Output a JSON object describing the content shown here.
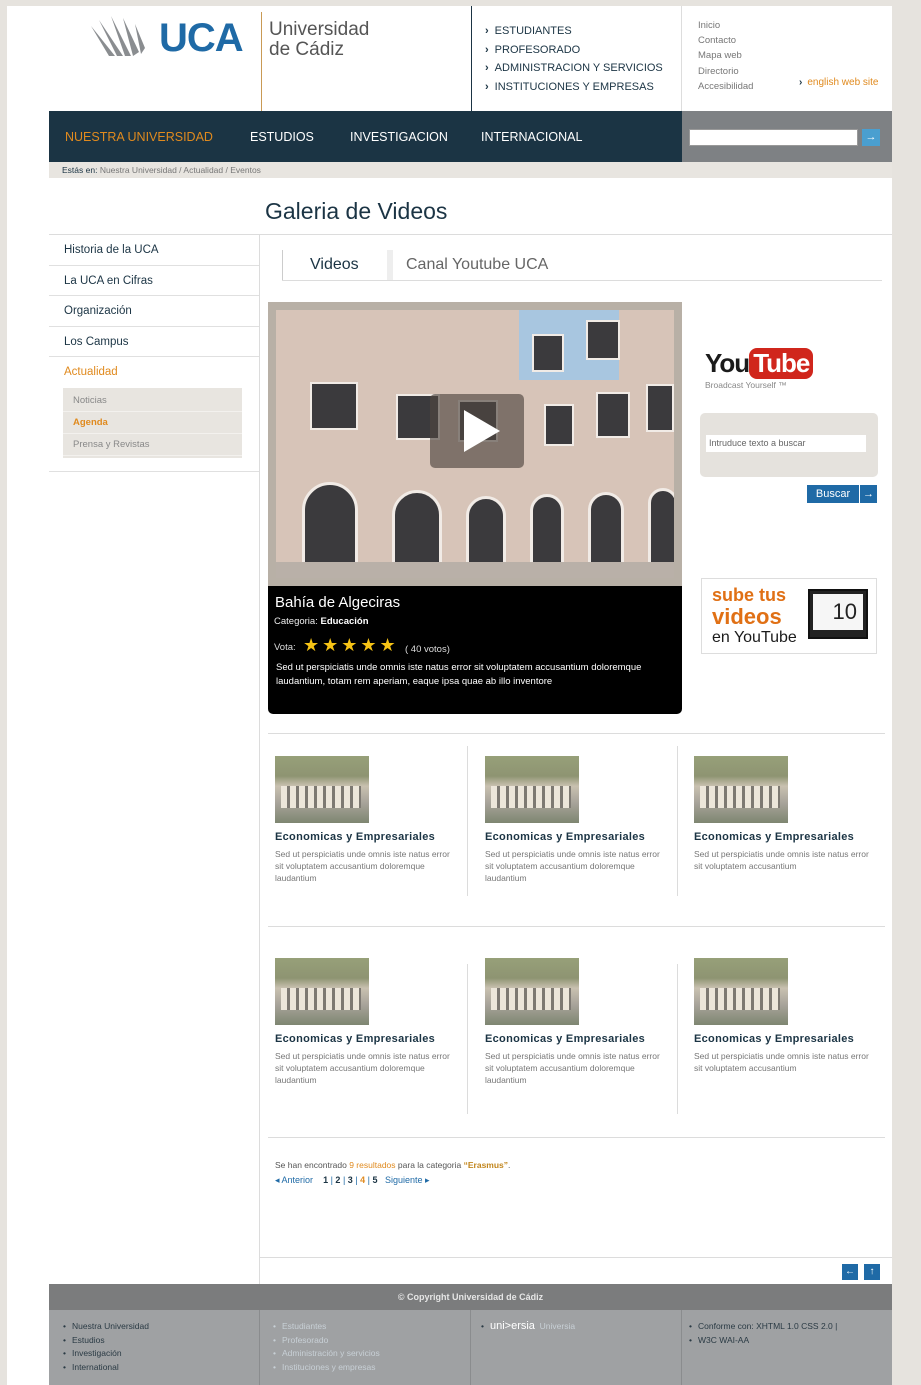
{
  "header": {
    "logo_text": "UCA",
    "uni_line1": "Universidad",
    "uni_line2": "de Cádiz",
    "top_nav": [
      "ESTUDIANTES",
      "PROFESORADO",
      "ADMINISTRACION Y SERVICIOS",
      "INSTITUCIONES Y EMPRESAS"
    ],
    "top_links": [
      "Inicio",
      "Contacto",
      "Mapa web",
      "Directorio",
      "Accesibilidad"
    ],
    "english_link": "english web site"
  },
  "main_nav": [
    "NUESTRA  UNIVERSIDAD",
    "ESTUDIOS",
    "INVESTIGACION",
    "INTERNACIONAL"
  ],
  "breadcrumb": {
    "label": "Estás en:",
    "path": "Nuestra Universidad  /  Actualidad  /  Eventos"
  },
  "page_title": "Galeria de Videos",
  "sidebar": {
    "items": [
      "Historia de la UCA",
      "La UCA en Cifras",
      "Organización",
      "Los Campus",
      "Actualidad"
    ],
    "sub_items": [
      "Noticias",
      "Agenda",
      "Prensa y Revistas"
    ]
  },
  "tabs": [
    "Videos",
    "Canal Youtube UCA"
  ],
  "player": {
    "title": "Bahía de Algeciras",
    "category_label": "Categoria:",
    "category": "Educación",
    "vote_label": "Vota:",
    "stars": "★★★★★",
    "rating": 5,
    "votes": "( 40 votos)",
    "description": "Sed ut perspiciatis unde omnis iste natus error sit voluptatem accusantium doloremque laudantium, totam rem aperiam, eaque ipsa quae ab illo inventore"
  },
  "youtube": {
    "you": "You",
    "tube": "Tube",
    "slogan": "Broadcast Yourself ™",
    "search_placeholder": "Intruduce texto a buscar",
    "search_button": "Buscar",
    "banner_line1": "sube tus",
    "banner_line2": "videos",
    "banner_line3": "en YouTube",
    "banner_tv": "10"
  },
  "videos": [
    {
      "title": "Economicas y Empresariales",
      "desc": "Sed ut perspiciatis unde omnis iste natus error sit voluptatem accusantium doloremque laudantium"
    },
    {
      "title": "Economicas y Empresariales",
      "desc": "Sed ut perspiciatis unde omnis iste natus error sit voluptatem accusantium doloremque laudantium"
    },
    {
      "title": "Economicas y Empresariales",
      "desc": "Sed ut perspiciatis unde omnis iste natus error sit voluptatem accusantium"
    },
    {
      "title": "Economicas y Empresariales",
      "desc": "Sed ut perspiciatis unde omnis iste natus error sit voluptatem accusantium doloremque laudantium"
    },
    {
      "title": "Economicas y Empresariales",
      "desc": "Sed ut perspiciatis unde omnis iste natus error sit voluptatem accusantium doloremque laudantium"
    },
    {
      "title": "Economicas y Empresariales",
      "desc": "Sed ut perspiciatis unde omnis iste natus error sit voluptatem accusantium"
    }
  ],
  "results": {
    "prefix": "Se han encontrado",
    "count": "9 resultados",
    "middle": "para la categoria",
    "category": "“Erasmus”",
    "suffix": "."
  },
  "pager": {
    "prev": "◂ Anterior",
    "pages": [
      "1",
      "2",
      "3",
      "4",
      "5"
    ],
    "next": "Siguiente ▸"
  },
  "footer": {
    "copyright": "© Copyright Universidad de Cádiz",
    "col1": [
      "Nuestra Universidad",
      "Estudios",
      "Investigación",
      "International"
    ],
    "col2": [
      "Estudiantes",
      "Profesorado",
      "Administración y servicios",
      "Instituciones y empresas"
    ],
    "col3_brand": "uni>ersia",
    "col3_text": "Universia",
    "col4": [
      "Conforme con: XHTML 1.0  CSS 2.0 |",
      "W3C  WAI-AA"
    ]
  },
  "colors": {
    "navy": "#1b3444",
    "accent_orange": "#e08a1e",
    "link_blue": "#1f6aa6",
    "youtube_red": "#d0261c"
  }
}
